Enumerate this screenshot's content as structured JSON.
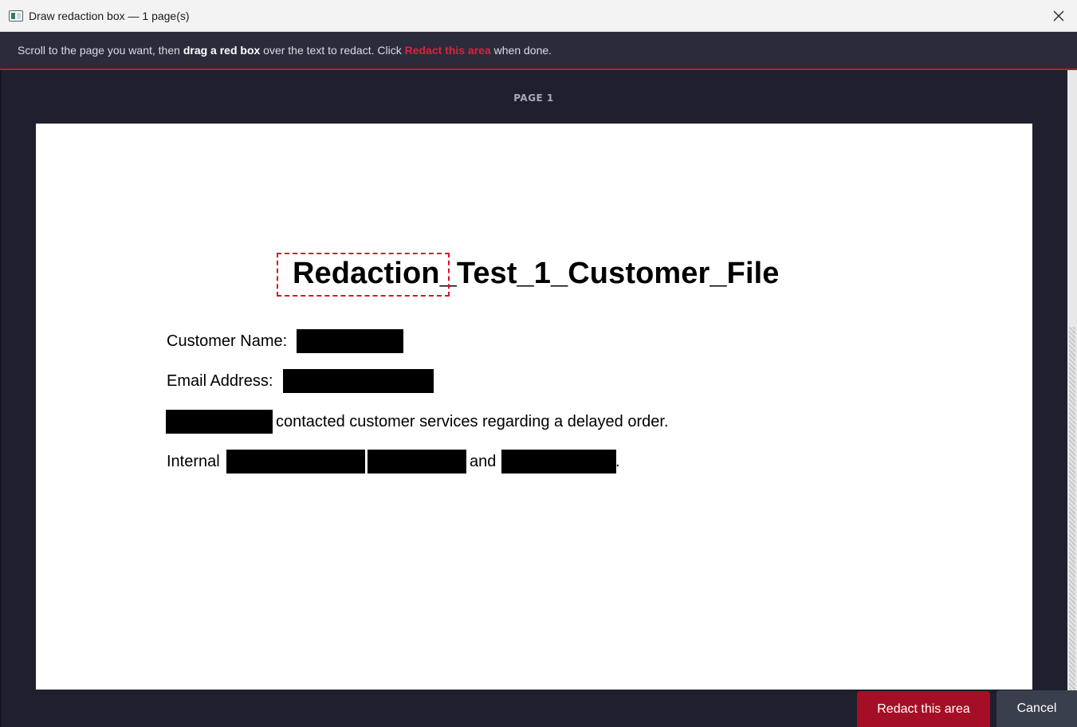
{
  "window": {
    "title": "Draw redaction box — 1 page(s)",
    "app_icon": "app-window-icon",
    "close_icon": "close-icon"
  },
  "banner": {
    "part1": "Scroll to the page you want, then ",
    "bold1": "drag a red box",
    "part2": " over the text to redact. Click ",
    "accent": "Redact this area",
    "part3": " when done.",
    "accent_color": "#e0203b"
  },
  "viewer": {
    "page_label": "PAGE 1"
  },
  "document": {
    "title": "Redaction_Test_1_Customer_File",
    "customer_name_label": "Customer Name:",
    "email_label": "Email Address:",
    "contact_text": "contacted customer services regarding a delayed order.",
    "internal_label": "Internal",
    "and_text": "and",
    "period": "."
  },
  "buttons": {
    "redact": "Redact this area",
    "cancel": "Cancel"
  },
  "colors": {
    "accent": "#a50f25",
    "banner_bg": "#2b2b3c",
    "viewer_bg": "#1f1f2e",
    "selection": "#e0102a"
  }
}
